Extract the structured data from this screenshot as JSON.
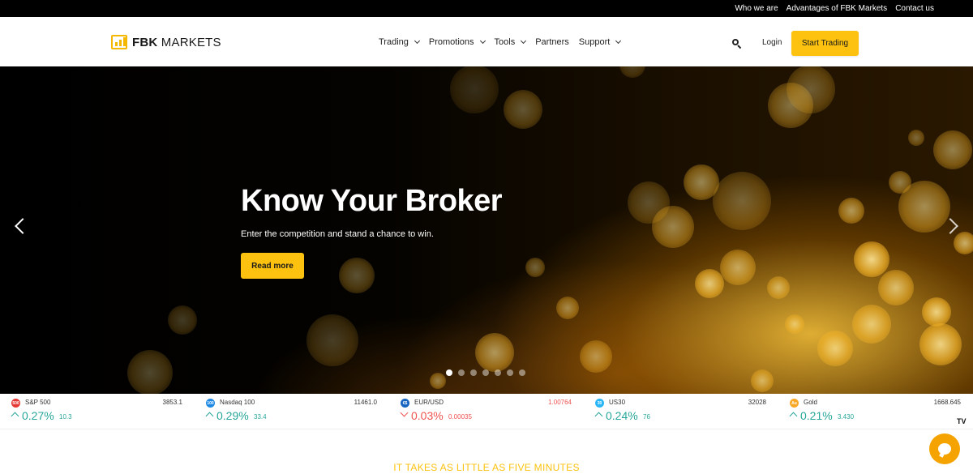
{
  "topbar": {
    "links": [
      "Who we are",
      "Advantages of FBK Markets",
      "Contact us"
    ]
  },
  "header": {
    "logo_bold": "FBK",
    "logo_rest": " MARKETS",
    "nav": [
      {
        "label": "Trading",
        "has_dropdown": true
      },
      {
        "label": "Promotions",
        "has_dropdown": true
      },
      {
        "label": "Tools",
        "has_dropdown": true
      },
      {
        "label": "Partners",
        "has_dropdown": false
      },
      {
        "label": "Support",
        "has_dropdown": true
      }
    ],
    "search_icon": "search-icon",
    "login_label": "Login",
    "cta_label": "Start Trading"
  },
  "hero": {
    "title": "Know Your Broker",
    "subtitle": "Enter the competition and stand a chance to win.",
    "button_label": "Read more",
    "slide_count": 7,
    "active_slide": 1
  },
  "ticker": [
    {
      "badge": "500",
      "badge_color": "#e53935",
      "name": "S&P 500",
      "price": "3853.1",
      "price_down": false,
      "direction": "up",
      "pct": "0.27%",
      "change": "10.3"
    },
    {
      "badge": "100",
      "badge_color": "#1e88e5",
      "name": "Nasdaq 100",
      "price": "11461.0",
      "price_down": false,
      "direction": "up",
      "pct": "0.29%",
      "change": "33.4"
    },
    {
      "badge": "€$",
      "badge_color": "#1565c0",
      "name": "EUR/USD",
      "price": "1.00764",
      "price_down": true,
      "direction": "down",
      "pct": "0.03%",
      "change": "0.00035"
    },
    {
      "badge": "30",
      "badge_color": "#29b6f6",
      "name": "US30",
      "price": "32028",
      "price_down": false,
      "direction": "up",
      "pct": "0.24%",
      "change": "76"
    },
    {
      "badge": "Au",
      "badge_color": "#f9a825",
      "name": "Gold",
      "price": "1668.645",
      "price_down": false,
      "direction": "up",
      "pct": "0.21%",
      "change": "3.430"
    }
  ],
  "ticker_watermark": "TV",
  "section": {
    "title": "IT TAKES AS LITTLE AS FIVE MINUTES"
  },
  "colors": {
    "accent": "#fcc20f",
    "up": "#26a69a",
    "down": "#ef5350"
  }
}
